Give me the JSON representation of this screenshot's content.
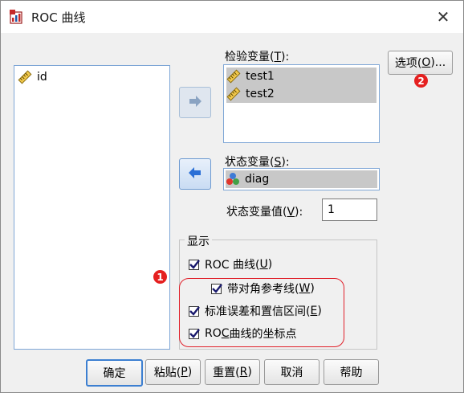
{
  "window": {
    "title": "ROC 曲线",
    "close_glyph": "✕"
  },
  "source_list": {
    "items": [
      {
        "label": "id",
        "icon": "ruler-icon"
      }
    ]
  },
  "test_vars": {
    "label_prefix": "检验变量(",
    "label_key": "T",
    "label_suffix": "):",
    "items": [
      {
        "label": "test1",
        "icon": "ruler-icon"
      },
      {
        "label": "test2",
        "icon": "ruler-icon"
      }
    ]
  },
  "state_var": {
    "label_prefix": "状态变量(",
    "label_key": "S",
    "label_suffix": "):",
    "item": {
      "label": "diag",
      "icon": "nominal-icon"
    }
  },
  "state_value": {
    "label_prefix": "状态变量值(",
    "label_key": "V",
    "label_suffix": "):",
    "value": "1"
  },
  "options_button": {
    "label_prefix": "选项(",
    "label_key": "O",
    "label_suffix": ")..."
  },
  "display_group": {
    "title": "显示",
    "checkboxes": [
      {
        "label_prefix": "ROC 曲线(",
        "key": "U",
        "label_suffix": ")",
        "checked": true
      },
      {
        "label_prefix": "带对角参考线(",
        "key": "W",
        "label_suffix": ")",
        "checked": true
      },
      {
        "label_prefix": "标准误差和置信区间(",
        "key": "E",
        "label_suffix": ")",
        "checked": true
      },
      {
        "label_prefix": "RO",
        "key": "C",
        "label_suffix": " 曲线的坐标点",
        "checked": true
      }
    ]
  },
  "bottom_buttons": {
    "ok": "确定",
    "paste_prefix": "粘贴(",
    "paste_key": "P",
    "paste_suffix": ")",
    "reset_prefix": "重置(",
    "reset_key": "R",
    "reset_suffix": ")",
    "cancel": "取消",
    "help": "帮助"
  },
  "annotations": {
    "badge_1": "1",
    "badge_2": "2",
    "highlight_color": "#e0202a"
  }
}
